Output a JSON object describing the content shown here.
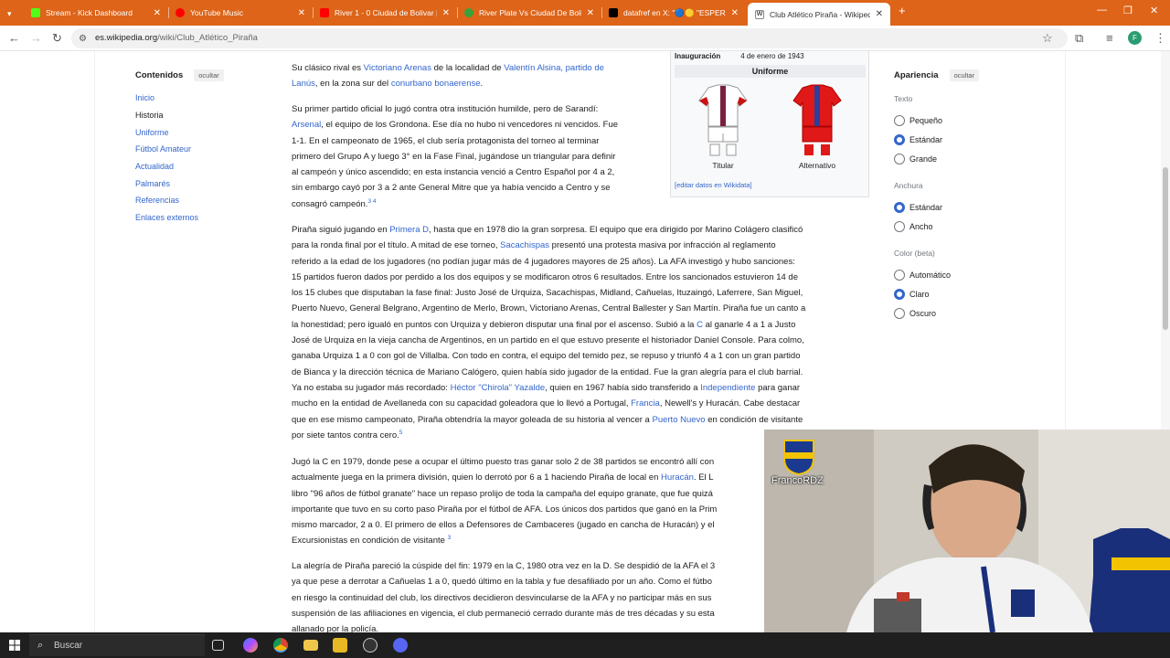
{
  "browser": {
    "tabs": [
      {
        "title": "Stream - Kick Dashboard",
        "icon": "kick-icon",
        "color": "#53fc18"
      },
      {
        "title": "YouTube Music",
        "icon": "youtube-music-icon",
        "color": "#ff0000"
      },
      {
        "title": "River 1 - 0 Ciudad de Bolivar | ",
        "icon": "youtube-icon",
        "color": "#ff0000"
      },
      {
        "title": "River Plate Vs Ciudad De Bolivar",
        "icon": "soccer-icon",
        "color": "#3aa13a"
      },
      {
        "title": "datafref en X: \"🔵🟡 \"ESPERAM",
        "icon": "x-icon",
        "color": "#000000"
      },
      {
        "title": "Club Atlético Piraña - Wikipedi",
        "icon": "wikipedia-icon",
        "color": "#ffffff"
      }
    ],
    "url": {
      "host": "es.wikipedia.org",
      "path": "/wiki/Club_Atlético_Piraña"
    },
    "profile_initial": "F"
  },
  "toc": {
    "title": "Contenidos",
    "hide_label": "ocultar",
    "items": [
      "Inicio",
      "Historia",
      "Uniforme",
      "Fútbol Amateur",
      "Actualidad",
      "Palmarés",
      "Referencias",
      "Enlaces externos"
    ],
    "current": "Historia"
  },
  "appearance": {
    "title": "Apariencia",
    "hide_label": "ocultar",
    "text_label": "Texto",
    "text_options": [
      "Pequeño",
      "Estándar",
      "Grande"
    ],
    "width_label": "Anchura",
    "width_options": [
      "Estándar",
      "Ancho"
    ],
    "color_label": "Color (beta)",
    "color_options": [
      "Automático",
      "Claro",
      "Oscuro"
    ],
    "selected": {
      "text": "Estándar",
      "width": "Estándar",
      "color": "Claro"
    }
  },
  "infobox": {
    "inauguration_label": "Inauguración",
    "inauguration_value": "4 de enero de 1943",
    "uniform_header": "Uniforme",
    "kit_home_label": "Titular",
    "kit_away_label": "Alternativo",
    "edit_link": "[editar datos en Wikidata]"
  },
  "article": {
    "p0": {
      "l1a": "Su clásico rival es ",
      "l1b": "Victoriano Arenas",
      "l1c": " de la localidad de ",
      "l1d": "Valentín Alsina, partido de",
      "l2a": "Lanús",
      "l2b": ", en la zona sur del ",
      "l2c": "conurbano bonaerense",
      "l2d": "."
    },
    "p1": {
      "l1": "Su primer partido oficial lo jugó contra otra institución humilde, pero de Sarandí:",
      "l2a": "Arsenal",
      "l2b": ", el equipo de los Grondona. Ese día no hubo ni vencedores ni vencidos. Fue",
      "l3": "1-1. En el campeonato de 1965, el club sería protagonista del torneo al terminar",
      "l4": "primero del Grupo A y luego 3° en la Fase Final, jugándose un triangular para definir",
      "l5": "al campeón y único ascendido; en esta instancia venció a Centro Español por 4 a 2,",
      "l6": "sin embargo cayó por 3 a 2 ante General Mitre que ya había vencido a Centro y se",
      "l7": "consagró campeón.",
      "refs": "3 4"
    },
    "p2": {
      "l1a": "Piraña siguió jugando en ",
      "l1b": "Primera D",
      "l1c": ", hasta que en 1978 dio la gran sorpresa. El equipo que era dirigido por Marino Colágero clasificó",
      "l2a": "para la ronda final por el título. A mitad de ese torneo, ",
      "l2b": "Sacachispas",
      "l2c": " presentó una protesta masiva por infracción al reglamento",
      "l3": "referido a la edad de los jugadores (no podían jugar más de 4 jugadores mayores de 25 años). La AFA investigó y hubo sanciones:",
      "l4": "15 partidos fueron dados por perdido a los dos equipos y se modificaron otros 6 resultados. Entre los sancionados estuvieron 14 de",
      "l5": "los 15 clubes que disputaban la fase final: Justo José de Urquiza, Sacachispas, Midland, Cañuelas, Ituzaingó, Laferrere, San Miguel,",
      "l6": "Puerto Nuevo, General Belgrano, Argentino de Merlo, Brown, Victoriano Arenas, Central Ballester y San Martín. Piraña fue un canto a",
      "l7a": "la honestidad; pero igualó en puntos con Urquiza y debieron disputar una final por el ascenso. Subió a la ",
      "l7b": "C",
      "l7c": " al ganarle 4 a 1 a Justo",
      "l8": "José de Urquiza en la vieja cancha de Argentinos, en un partido en el que estuvo presente el historiador Daniel Console. Para colmo,",
      "l9": "ganaba Urquiza 1 a 0 con gol de Villalba. Con todo en contra, el equipo del temido pez, se repuso y triunfó 4 a 1 con un gran partido",
      "l10": "de Bianca y la dirección técnica de Mariano Calógero, quien había sido jugador de la entidad. Fue la gran alegría para el club barrial.",
      "l11a": "Ya no estaba su jugador más recordado: ",
      "l11b": "Héctor \"Chirola\" Yazalde",
      "l11c": ", quien en 1967 había sido transferido a ",
      "l11d": "Independiente",
      "l11e": " para ganar",
      "l12a": "mucho en la entidad de Avellaneda con su capacidad goleadora que lo llevó a Portugal, ",
      "l12b": "Francia",
      "l12c": ", Newell's y Huracán. Cabe destacar",
      "l13a": "que en ese mismo campeonato, Piraña obtendría la mayor goleada de su historia al vencer a ",
      "l13b": "Puerto Nuevo",
      "l13c": " en condición de visitante",
      "l14": "por siete tantos contra cero.",
      "ref": "5"
    },
    "p3": {
      "l1": "Jugó la C en 1979, donde pese a ocupar el último puesto tras ganar solo 2 de 38 partidos se encontró allí con",
      "l2a": "actualmente juega en la primera división, quien lo derrotó por 6 a 1 haciendo Piraña de local en ",
      "l2b": "Huracán",
      "l2c": ". El L",
      "l3": "libro \"96 años de fútbol granate\" hace un repaso prolijo de toda la campaña del equipo granate, que fue quizá",
      "l4": "importante que tuvo en su corto paso Piraña por el fútbol de AFA. Los únicos dos partidos que ganó en la Prim",
      "l5": "mismo marcador, 2 a 0. El primero de ellos a Defensores de Cambaceres (jugado en cancha de Huracán) y el",
      "l6": "Excursionistas en condición de visitante",
      "ref": "3"
    },
    "p4": {
      "l1": "La alegría de Piraña pareció la cúspide del fin: 1979 en la C, 1980 otra vez en la D. Se despidió de la AFA el 3",
      "l2": "ya que pese a derrotar a Cañuelas 1 a 0, quedó último en la tabla y fue desafiliado por un año. Como el fútbo",
      "l3": "en riesgo la continuidad del club, los directivos decidieron desvincularse de la AFA y no participar más en sus",
      "l4": "suspensión de las afiliaciones en vigencia, el club permaneció cerrado durante más de tres décadas y su esta",
      "l5": "allanado por la policía."
    }
  },
  "webcam": {
    "streamer_name": "FrancoRDZ"
  },
  "taskbar": {
    "search_placeholder": "Buscar"
  }
}
